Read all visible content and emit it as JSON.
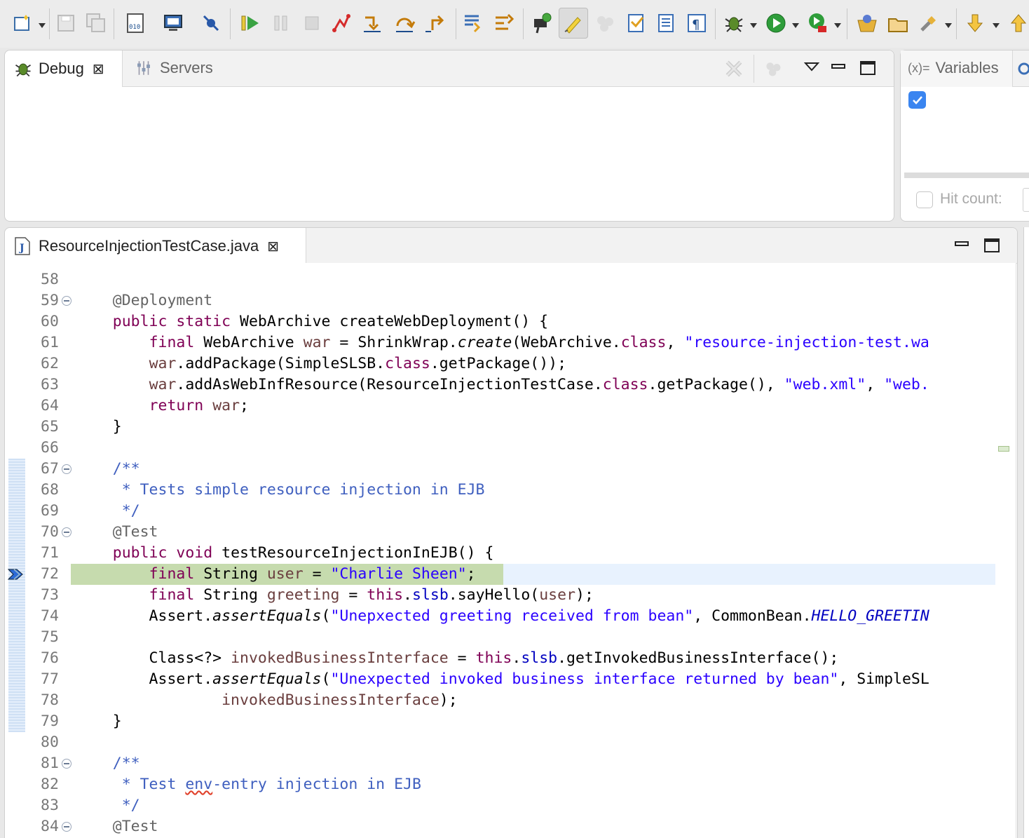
{
  "toolbar": {
    "icons": [
      "new-file-icon",
      "save-icon",
      "save-all-icon",
      "binary-file-icon",
      "console-monitor-icon",
      "skip-breakpoints-icon",
      "resume-icon",
      "suspend-icon",
      "terminate-icon",
      "disconnect-icon",
      "step-into-icon",
      "step-over-icon",
      "step-return-icon",
      "drop-to-frame-icon",
      "use-step-filters-icon",
      "inspect-icon",
      "highlight-pen-icon",
      "threads-icon",
      "toggle-mark-icon",
      "block-selection-icon",
      "show-whitespace-icon",
      "debug-icon",
      "run-icon",
      "run-coverage-icon",
      "open-perspective-icon",
      "open-folder-icon",
      "external-tools-icon",
      "next-annotation-icon",
      "previous-annotation-icon"
    ]
  },
  "debug_panel": {
    "tabs": [
      {
        "label": "Debug",
        "icon": "bug-icon",
        "active": true
      },
      {
        "label": "Servers",
        "icon": "servers-icon",
        "active": false
      }
    ]
  },
  "variables_panel": {
    "tab_label": "Variables",
    "tab_prefix": "(x)=",
    "checkbox_checked": true,
    "hit_count_label": "Hit count:"
  },
  "editor": {
    "tab_label": "ResourceInjectionTestCase.java",
    "current_line": 72,
    "lines": [
      {
        "n": "58",
        "fold": false
      },
      {
        "n": "59",
        "fold": true
      },
      {
        "n": "60",
        "fold": false
      },
      {
        "n": "61",
        "fold": false
      },
      {
        "n": "62",
        "fold": false
      },
      {
        "n": "63",
        "fold": false
      },
      {
        "n": "64",
        "fold": false
      },
      {
        "n": "65",
        "fold": false
      },
      {
        "n": "66",
        "fold": false
      },
      {
        "n": "67",
        "fold": true
      },
      {
        "n": "68",
        "fold": false
      },
      {
        "n": "69",
        "fold": false
      },
      {
        "n": "70",
        "fold": true
      },
      {
        "n": "71",
        "fold": false
      },
      {
        "n": "72",
        "fold": false
      },
      {
        "n": "73",
        "fold": false
      },
      {
        "n": "74",
        "fold": false
      },
      {
        "n": "75",
        "fold": false
      },
      {
        "n": "76",
        "fold": false
      },
      {
        "n": "77",
        "fold": false
      },
      {
        "n": "78",
        "fold": false
      },
      {
        "n": "79",
        "fold": false
      },
      {
        "n": "80",
        "fold": false
      },
      {
        "n": "81",
        "fold": true
      },
      {
        "n": "82",
        "fold": false
      },
      {
        "n": "83",
        "fold": false
      },
      {
        "n": "84",
        "fold": true
      }
    ],
    "code": [
      [],
      [
        [
          "ann",
          "    @Deployment"
        ]
      ],
      [
        [
          "",
          "    "
        ],
        [
          "kw",
          "public"
        ],
        [
          "",
          " "
        ],
        [
          "kw",
          "static"
        ],
        [
          "",
          " WebArchive createWebDeployment() {"
        ]
      ],
      [
        [
          "",
          "        "
        ],
        [
          "kw",
          "final"
        ],
        [
          "",
          " WebArchive "
        ],
        [
          "var",
          "war"
        ],
        [
          "",
          " = ShrinkWrap."
        ],
        [
          "ital",
          "create"
        ],
        [
          "",
          "(WebArchive."
        ],
        [
          "kw",
          "class"
        ],
        [
          "",
          ", "
        ],
        [
          "str",
          "\"resource-injection-test.wa"
        ]
      ],
      [
        [
          "",
          "        "
        ],
        [
          "var",
          "war"
        ],
        [
          "",
          ".addPackage(SimpleSLSB."
        ],
        [
          "kw",
          "class"
        ],
        [
          "",
          ".getPackage());"
        ]
      ],
      [
        [
          "",
          "        "
        ],
        [
          "var",
          "war"
        ],
        [
          "",
          ".addAsWebInfResource(ResourceInjectionTestCase."
        ],
        [
          "kw",
          "class"
        ],
        [
          "",
          ".getPackage(), "
        ],
        [
          "str",
          "\"web.xml\""
        ],
        [
          "",
          ", "
        ],
        [
          "str",
          "\"web."
        ]
      ],
      [
        [
          "",
          "        "
        ],
        [
          "kw",
          "return"
        ],
        [
          "",
          " "
        ],
        [
          "var",
          "war"
        ],
        [
          "",
          ";"
        ]
      ],
      [
        [
          "",
          "    }"
        ]
      ],
      [],
      [
        [
          "cmt",
          "    /**"
        ]
      ],
      [
        [
          "cmt",
          "     * Tests simple resource injection in EJB"
        ]
      ],
      [
        [
          "cmt",
          "     */"
        ]
      ],
      [
        [
          "ann",
          "    @Test"
        ]
      ],
      [
        [
          "",
          "    "
        ],
        [
          "kw",
          "public"
        ],
        [
          "",
          " "
        ],
        [
          "kw",
          "void"
        ],
        [
          "",
          " testResourceInjectionInEJB() {"
        ]
      ],
      [
        [
          "",
          "        "
        ],
        [
          "kw",
          "final"
        ],
        [
          "",
          " String "
        ],
        [
          "var",
          "user"
        ],
        [
          "",
          " = "
        ],
        [
          "str",
          "\"Charlie Sheen\""
        ],
        [
          "",
          ";"
        ]
      ],
      [
        [
          "",
          "        "
        ],
        [
          "kw",
          "final"
        ],
        [
          "",
          " String "
        ],
        [
          "var",
          "greeting"
        ],
        [
          "",
          " = "
        ],
        [
          "kw",
          "this"
        ],
        [
          "",
          "."
        ],
        [
          "fld",
          "slsb"
        ],
        [
          "",
          ".sayHello("
        ],
        [
          "var",
          "user"
        ],
        [
          "",
          ");"
        ]
      ],
      [
        [
          "",
          "        Assert."
        ],
        [
          "ital",
          "assertEquals"
        ],
        [
          "",
          "("
        ],
        [
          "str",
          "\"Unepxected greeting received from bean\""
        ],
        [
          "",
          ", CommonBean."
        ],
        [
          "sfld",
          "HELLO_GREETIN"
        ]
      ],
      [],
      [
        [
          "",
          "        Class<?> "
        ],
        [
          "var",
          "invokedBusinessInterface"
        ],
        [
          "",
          " = "
        ],
        [
          "kw",
          "this"
        ],
        [
          "",
          "."
        ],
        [
          "fld",
          "slsb"
        ],
        [
          "",
          ".getInvokedBusinessInterface();"
        ]
      ],
      [
        [
          "",
          "        Assert."
        ],
        [
          "ital",
          "assertEquals"
        ],
        [
          "",
          "("
        ],
        [
          "str",
          "\"Unexpected invoked business interface returned by bean\""
        ],
        [
          "",
          ", SimpleSL"
        ]
      ],
      [
        [
          "",
          "                "
        ],
        [
          "var",
          "invokedBusinessInterface"
        ],
        [
          "",
          ");"
        ]
      ],
      [
        [
          "",
          "    }"
        ]
      ],
      [],
      [
        [
          "cmt",
          "    /**"
        ]
      ],
      [
        [
          "cmt",
          "     * Test env-entry injection in EJB"
        ]
      ],
      [
        [
          "cmt",
          "     */"
        ]
      ],
      [
        [
          "ann",
          "    @Test"
        ]
      ]
    ]
  },
  "colors": {
    "current_line_bg": "#e8f2fe",
    "current_code_highlight": "#c6dbae",
    "keyword": "#7f0055",
    "string": "#2a00ff",
    "comment": "#3f5fbf"
  }
}
